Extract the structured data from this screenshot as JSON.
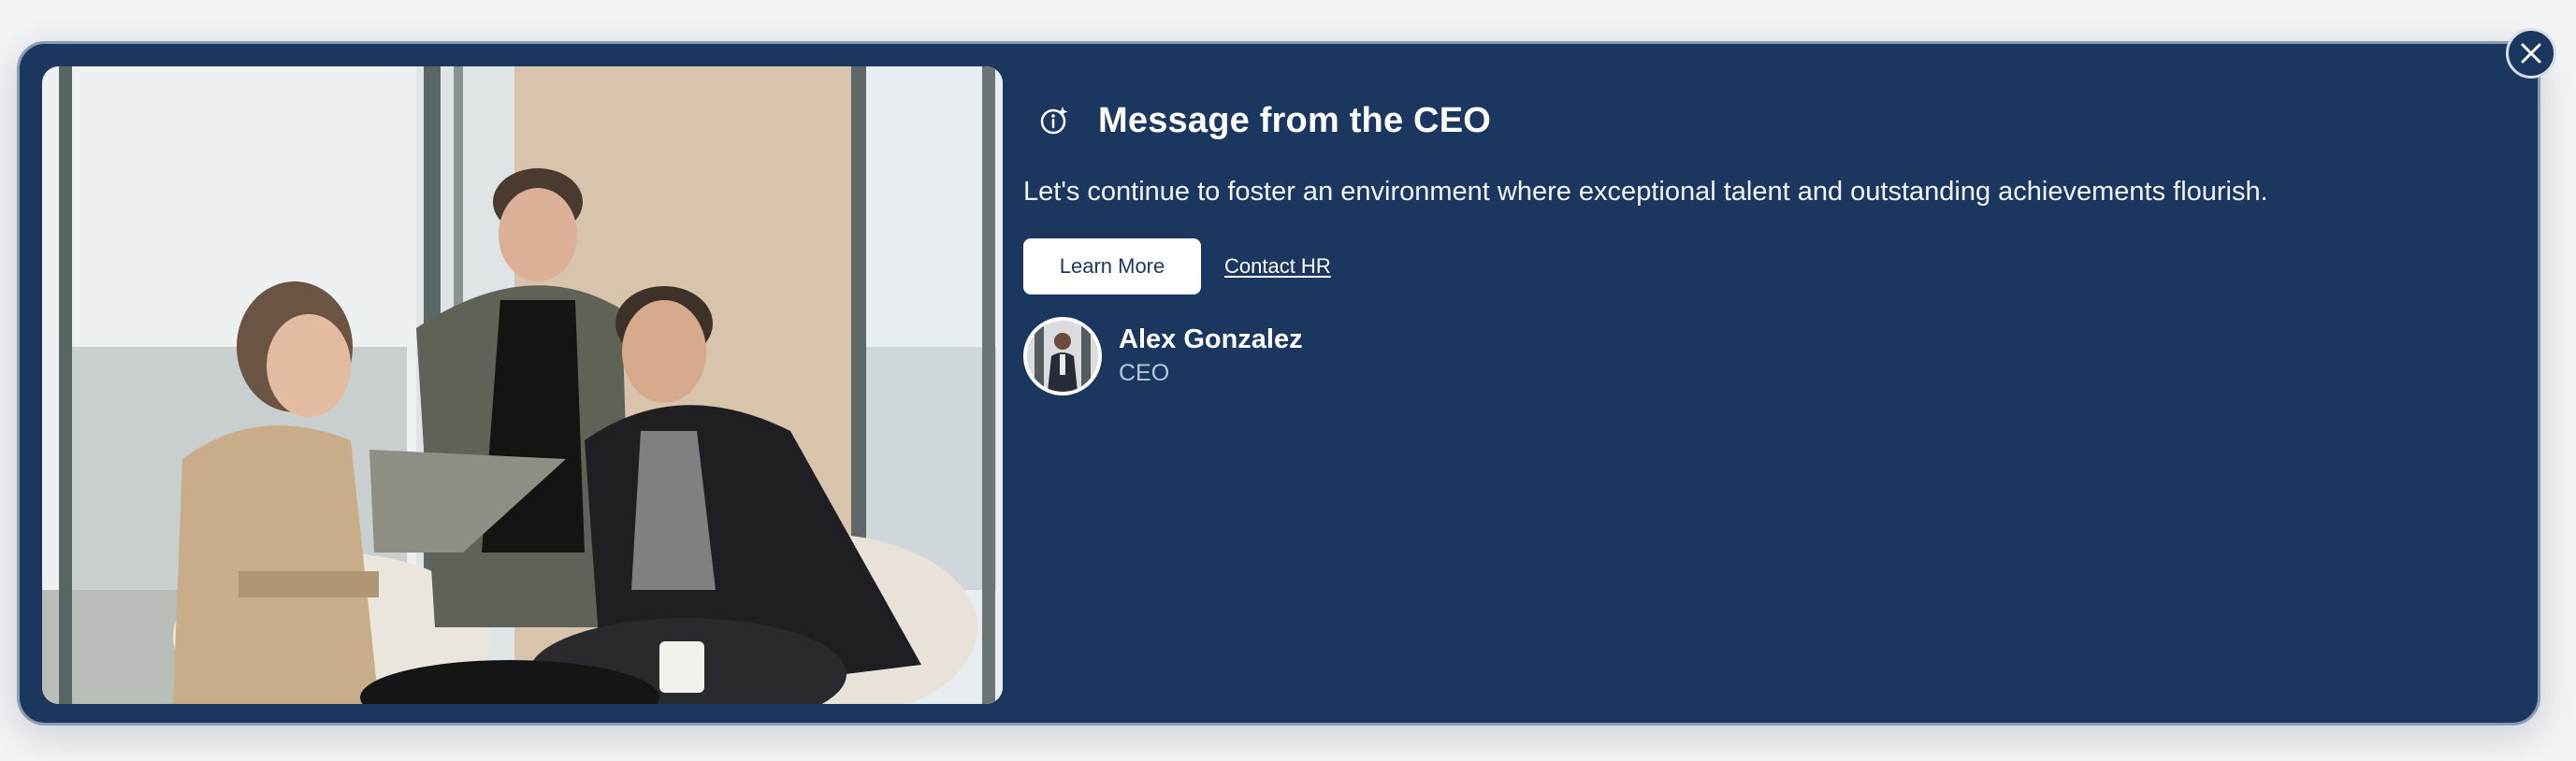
{
  "banner": {
    "title": "Message from the CEO",
    "message": "Let's continue to foster an environment where exceptional talent and outstanding achievements flourish.",
    "primary_button_label": "Learn More",
    "secondary_link_label": "Contact HR",
    "title_icon": "sparkle-info-icon",
    "close_icon": "close-icon"
  },
  "author": {
    "name": "Alex Gonzalez",
    "role": "CEO"
  },
  "colors": {
    "panel_background": "#1b375f",
    "panel_border": "#8b9bb5",
    "button_background": "#ffffff",
    "button_text": "#1b375f",
    "role_text": "#b8c6dc"
  }
}
